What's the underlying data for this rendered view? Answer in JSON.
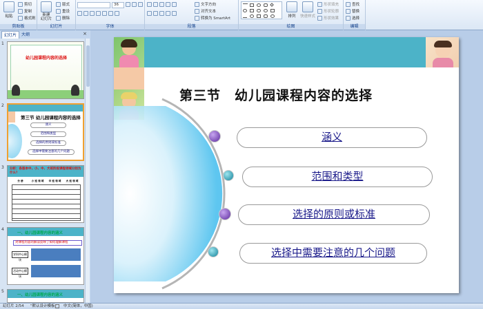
{
  "ribbon": {
    "clipboard": {
      "paste": "粘贴",
      "cut": "剪切",
      "copy": "复制",
      "format_painter": "格式刷",
      "label": "剪贴板"
    },
    "slides": {
      "new_slide": "新建\n幻灯片",
      "layout": "版式",
      "reset": "重设",
      "delete": "删除",
      "label": "幻灯片"
    },
    "font": {
      "label": "字体",
      "font_size": "36"
    },
    "paragraph": {
      "text_direction": "文字方向",
      "align_text": "对齐文本",
      "smartart": "转换为 SmartArt",
      "label": "段落"
    },
    "drawing": {
      "arrange": "排列",
      "quick_styles": "快速样式",
      "shape_fill": "形状填充",
      "shape_outline": "形状轮廓",
      "shape_effects": "形状效果",
      "label": "绘图"
    },
    "editing": {
      "find": "查找",
      "replace": "替换",
      "select": "选择",
      "label": "编辑"
    }
  },
  "panel": {
    "tabs": [
      "幻灯片",
      "大纲"
    ],
    "close": "×",
    "slides": [
      {
        "num": "1",
        "title": "幼儿园课程内容的选择"
      },
      {
        "num": "2",
        "title": "第三节 幼儿园课程内容的选择",
        "items": [
          "涵义",
          "范围和类型",
          "选择的原则或标准",
          "选择中需要注意的几个问题"
        ]
      },
      {
        "num": "3",
        "title": "分析：各版本中，小、中、大班阶段课程领域分别为什么？",
        "headers": [
          "分 册",
          "小 班 领 域",
          "中 班 领 域",
          "大 班 领 域"
        ]
      },
      {
        "num": "4",
        "title": "一、幼儿园课程内容的涵义",
        "line1": "对课程内容的解读反映了如何理解课程",
        "box1": "学科中心模块",
        "box2": "活动中心模块"
      },
      {
        "num": "5",
        "title": "一、幼儿园课程内容的涵义"
      }
    ]
  },
  "slide": {
    "title": "第三节　幼儿园课程内容的选择",
    "items": [
      "涵义",
      "范围和类型",
      "选择的原则或标准",
      "选择中需要注意的几个问题"
    ]
  },
  "status": {
    "slide_info": "幻灯片 2/54",
    "theme": "\"默认设计模板\"",
    "language": "中文(简体，中国)"
  }
}
